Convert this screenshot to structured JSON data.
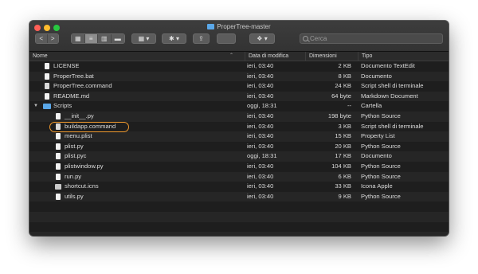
{
  "window": {
    "title": "ProperTree-master",
    "search_placeholder": "Cerca"
  },
  "toolbar": {
    "back_label": "<",
    "forward_label": ">",
    "group_label": "▾",
    "action_label": "▾",
    "tags_label": "",
    "dropbox_label": "▾"
  },
  "columns": {
    "name": "Nome",
    "date": "Data di modifica",
    "size": "Dimensioni",
    "type": "Tipo"
  },
  "files": [
    {
      "name": "LICENSE",
      "date": "ieri, 03:40",
      "size": "2 KB",
      "type": "Documento TextEdit",
      "icon": "document-icon"
    },
    {
      "name": "ProperTree.bat",
      "date": "ieri, 03:40",
      "size": "8 KB",
      "type": "Documento",
      "icon": "document-icon"
    },
    {
      "name": "ProperTree.command",
      "date": "ieri, 03:40",
      "size": "24 KB",
      "type": "Script shell di terminale",
      "icon": "script-icon"
    },
    {
      "name": "README.md",
      "date": "ieri, 03:40",
      "size": "64 byte",
      "type": "Markdown Document",
      "icon": "document-icon"
    },
    {
      "name": "Scripts",
      "date": "oggi, 18:31",
      "size": "--",
      "type": "Cartella",
      "icon": "folder-icon"
    },
    {
      "name": "__init__.py",
      "date": "ieri, 03:40",
      "size": "198 byte",
      "type": "Python Source",
      "icon": "document-icon"
    },
    {
      "name": "buildapp.command",
      "date": "ieri, 03:40",
      "size": "3 KB",
      "type": "Script shell di terminale",
      "icon": "script-icon"
    },
    {
      "name": "menu.plist",
      "date": "ieri, 03:40",
      "size": "15 KB",
      "type": "Property List",
      "icon": "document-icon"
    },
    {
      "name": "plist.py",
      "date": "ieri, 03:40",
      "size": "20 KB",
      "type": "Python Source",
      "icon": "document-icon"
    },
    {
      "name": "plist.pyc",
      "date": "oggi, 18:31",
      "size": "17 KB",
      "type": "Documento",
      "icon": "document-icon"
    },
    {
      "name": "plistwindow.py",
      "date": "ieri, 03:40",
      "size": "104 KB",
      "type": "Python Source",
      "icon": "document-icon"
    },
    {
      "name": "run.py",
      "date": "ieri, 03:40",
      "size": "6 KB",
      "type": "Python Source",
      "icon": "document-icon"
    },
    {
      "name": "shortcut.icns",
      "date": "ieri, 03:40",
      "size": "33 KB",
      "type": "Icona Apple",
      "icon": "icns-icon"
    },
    {
      "name": "utils.py",
      "date": "ieri, 03:40",
      "size": "9 KB",
      "type": "Python Source",
      "icon": "document-icon"
    }
  ],
  "colors": {
    "highlight": "#f19a2e",
    "folder": "#5aa7e8"
  }
}
